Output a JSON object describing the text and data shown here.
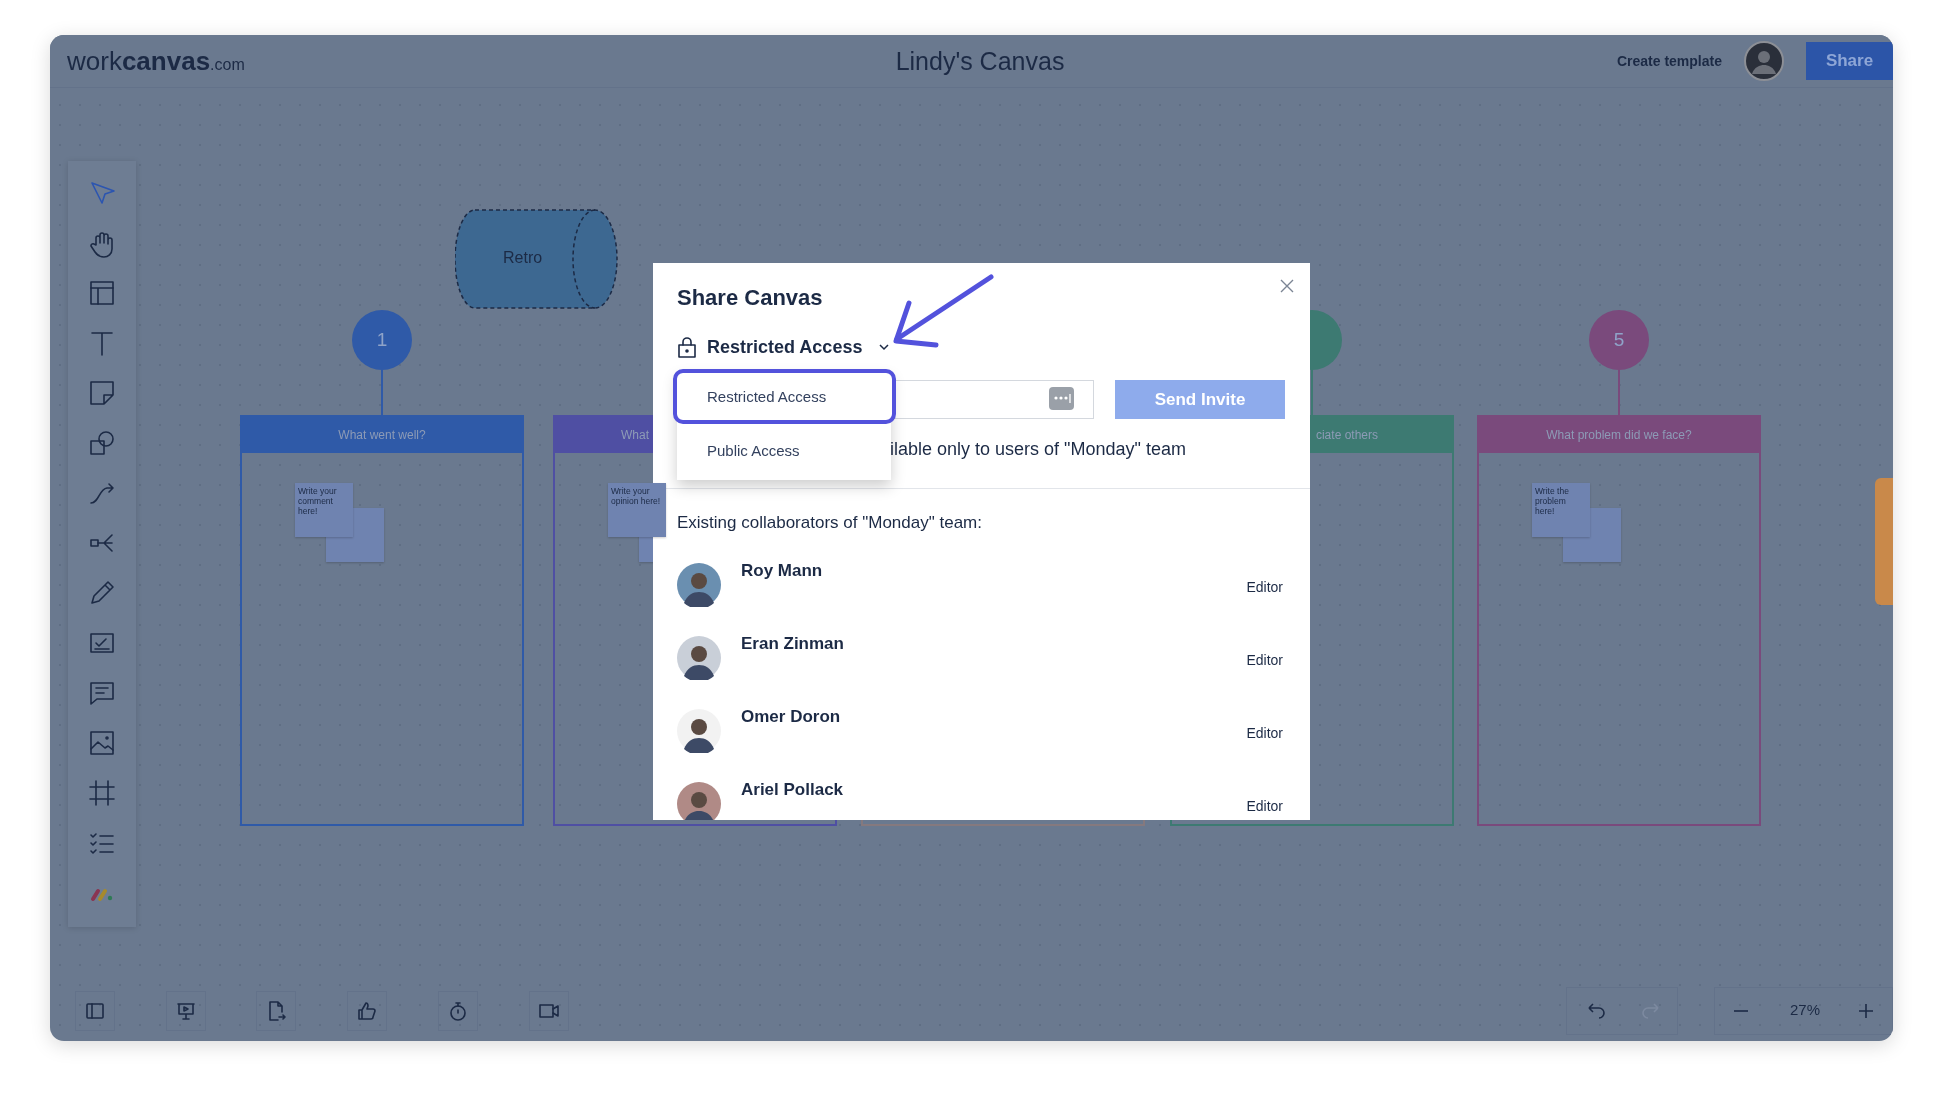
{
  "header": {
    "logo": {
      "light": "work",
      "bold": "canvas",
      "suffix": ".com"
    },
    "title": "Lindy's Canvas",
    "create_template": "Create template",
    "share": "Share"
  },
  "tools": [
    {
      "kind": "pointer",
      "selected": true
    },
    {
      "kind": "hand",
      "selected": false
    },
    {
      "kind": "layout",
      "selected": false
    },
    {
      "kind": "text",
      "selected": false
    },
    {
      "kind": "note",
      "selected": false
    },
    {
      "kind": "shapes",
      "selected": false
    },
    {
      "kind": "connector",
      "selected": false
    },
    {
      "kind": "mindmap",
      "selected": false
    },
    {
      "kind": "pen",
      "selected": false
    },
    {
      "kind": "task",
      "selected": false
    },
    {
      "kind": "comment",
      "selected": false
    },
    {
      "kind": "image",
      "selected": false
    },
    {
      "kind": "frame",
      "selected": false
    },
    {
      "kind": "checklist",
      "selected": false
    }
  ],
  "canvas": {
    "shape": {
      "label": "Retro"
    },
    "columns": [
      {
        "marker": true,
        "number": "1",
        "header": "What went well?",
        "color": "#2f5aa8",
        "notes": [
          {
            "kind": "blank"
          },
          {
            "kind": "text",
            "text": "Write your comment here!"
          }
        ]
      },
      {
        "marker": false,
        "header": "What",
        "color": "#4f4fa3",
        "notes": [
          {
            "kind": "blank"
          },
          {
            "kind": "text",
            "text": "Write your opinion here!"
          }
        ]
      },
      {
        "marker": false,
        "color": "#85797e"
      },
      {
        "marker": true,
        "header": "ciate others",
        "color": "#3d7a72"
      },
      {
        "marker": true,
        "number": "5",
        "header": "What problem did we face?",
        "color": "#7a4a7c",
        "notes": [
          {
            "kind": "blank"
          },
          {
            "kind": "text",
            "text": "Write the problem here!"
          }
        ]
      }
    ]
  },
  "bottom_bar": {
    "zoom": "27%"
  },
  "dialog": {
    "title": "Share Canvas",
    "access": "Restricted Access",
    "menu": [
      {
        "label": "Restricted Access",
        "selected": true
      },
      {
        "label": "Public Access",
        "selected": false
      }
    ],
    "send_button": "Send Invite",
    "availability": "ilable only to users of \"Monday\" team",
    "collaborators_title": "Existing collaborators of \"Monday\" team:",
    "collaborators": [
      {
        "name": "Roy Mann",
        "role": "Editor"
      },
      {
        "name": "Eran Zinman",
        "role": "Editor"
      },
      {
        "name": "Omer Doron",
        "role": "Editor"
      },
      {
        "name": "Ariel Pollack",
        "role": "Editor"
      }
    ]
  }
}
